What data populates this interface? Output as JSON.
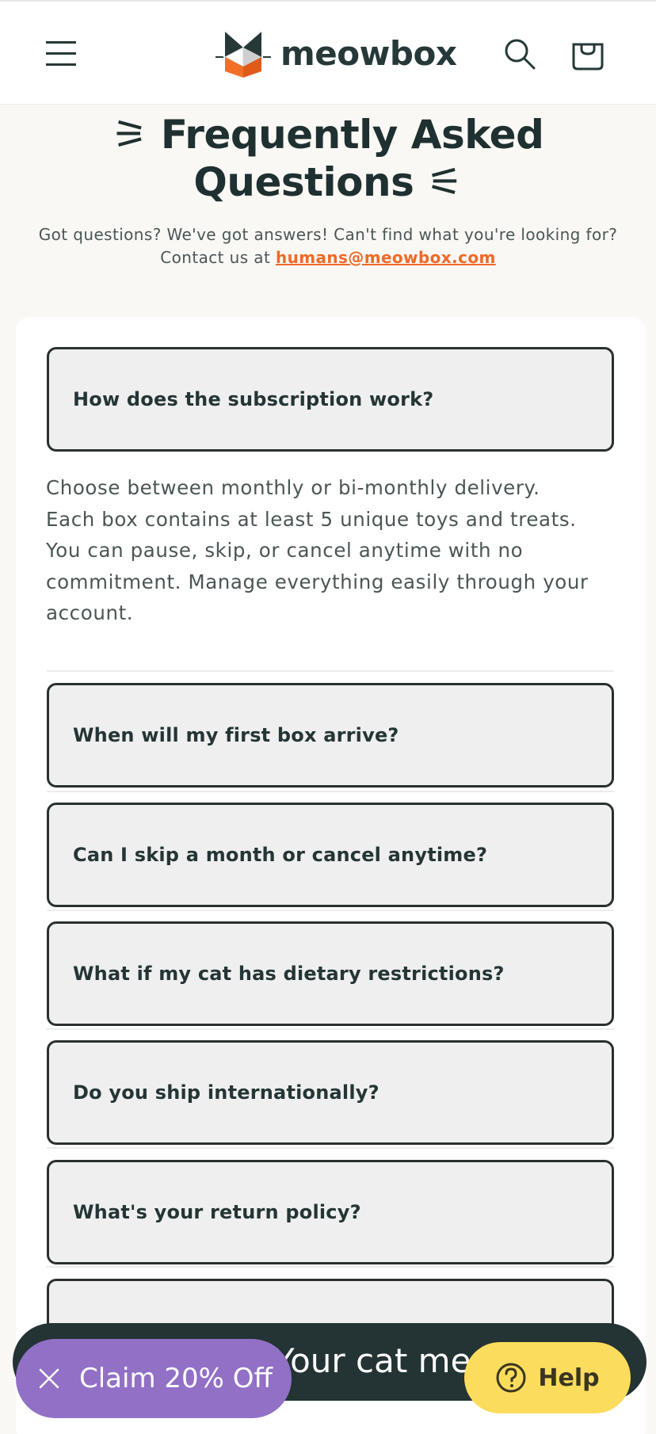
{
  "header": {
    "brand": "meowbox",
    "menu_icon": "hamburger-menu-icon",
    "search_icon": "search-icon",
    "cart_icon": "shopping-bag-icon"
  },
  "hero": {
    "title_line1": "⚞ Frequently Asked",
    "title_line2": "Questions ⚟",
    "subtitle_prefix": "Got questions? We've got answers! Can't find what you're looking for? Contact us at ",
    "email": "humans@meowbox.com"
  },
  "faq": {
    "items": [
      {
        "question": "How does the subscription work?",
        "expanded": true
      },
      {
        "question": "When will my first box arrive?",
        "expanded": false
      },
      {
        "question": "Can I skip a month or cancel anytime?",
        "expanded": false
      },
      {
        "question": "What if my cat has dietary restrictions?",
        "expanded": false
      },
      {
        "question": "Do you ship internationally?",
        "expanded": false
      },
      {
        "question": "What's your return policy?",
        "expanded": false
      },
      {
        "question": "",
        "expanded": false
      }
    ],
    "answer_lines": [
      "Choose between monthly or bi-monthly delivery.",
      "Each box contains at least 5 unique toys and treats.",
      "You can pause, skip, or cancel anytime with no",
      "commitment. Manage everything easily through your",
      "account."
    ]
  },
  "bottom_bar": {
    "text": "Your cat meows"
  },
  "promo": {
    "label": "Claim 20% Off",
    "close_icon": "close-icon"
  },
  "help": {
    "label": "Help",
    "icon": "question-circle-icon"
  },
  "colors": {
    "accent": "#f06a28",
    "promo": "#9170c6",
    "help": "#fcdc5c",
    "dark": "#243333"
  }
}
